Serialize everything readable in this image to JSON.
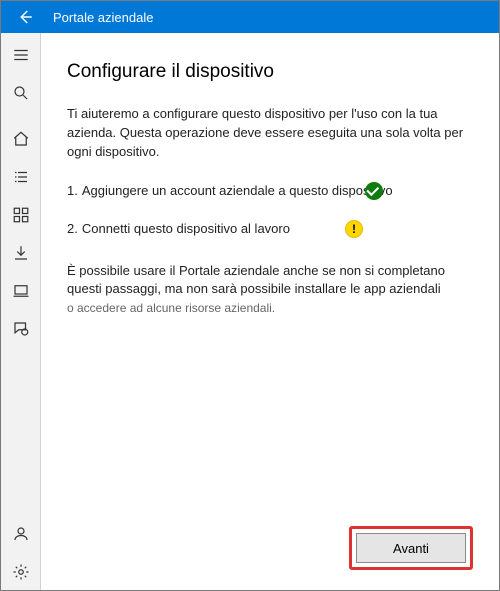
{
  "titlebar": {
    "title": "Portale aziendale"
  },
  "content": {
    "heading": "Configurare il dispositivo",
    "description": "Ti aiuteremo a configurare questo dispositivo per l'uso con la tua azienda. Questa operazione deve essere eseguita una sola volta per ogni dispositivo.",
    "steps": [
      {
        "num": "1.",
        "text": "Aggiungere un account aziendale a questo dispositivo",
        "status": "ok"
      },
      {
        "num": "2.",
        "text": "Connetti questo dispositivo al lavoro",
        "status": "warn",
        "warn_char": "!"
      }
    ],
    "note_main": "È possibile usare il Portale aziendale anche se non si completano questi passaggi, ma non sarà possibile installare le app aziendali",
    "note_sub": "o accedere ad alcune risorse aziendali.",
    "next_button": "Avanti"
  },
  "sidebar": {
    "items": [
      {
        "name": "menu"
      },
      {
        "name": "search"
      },
      {
        "name": "home"
      },
      {
        "name": "list"
      },
      {
        "name": "apps"
      },
      {
        "name": "downloads"
      },
      {
        "name": "devices"
      },
      {
        "name": "support"
      }
    ],
    "bottom": [
      {
        "name": "account"
      },
      {
        "name": "settings"
      }
    ]
  }
}
